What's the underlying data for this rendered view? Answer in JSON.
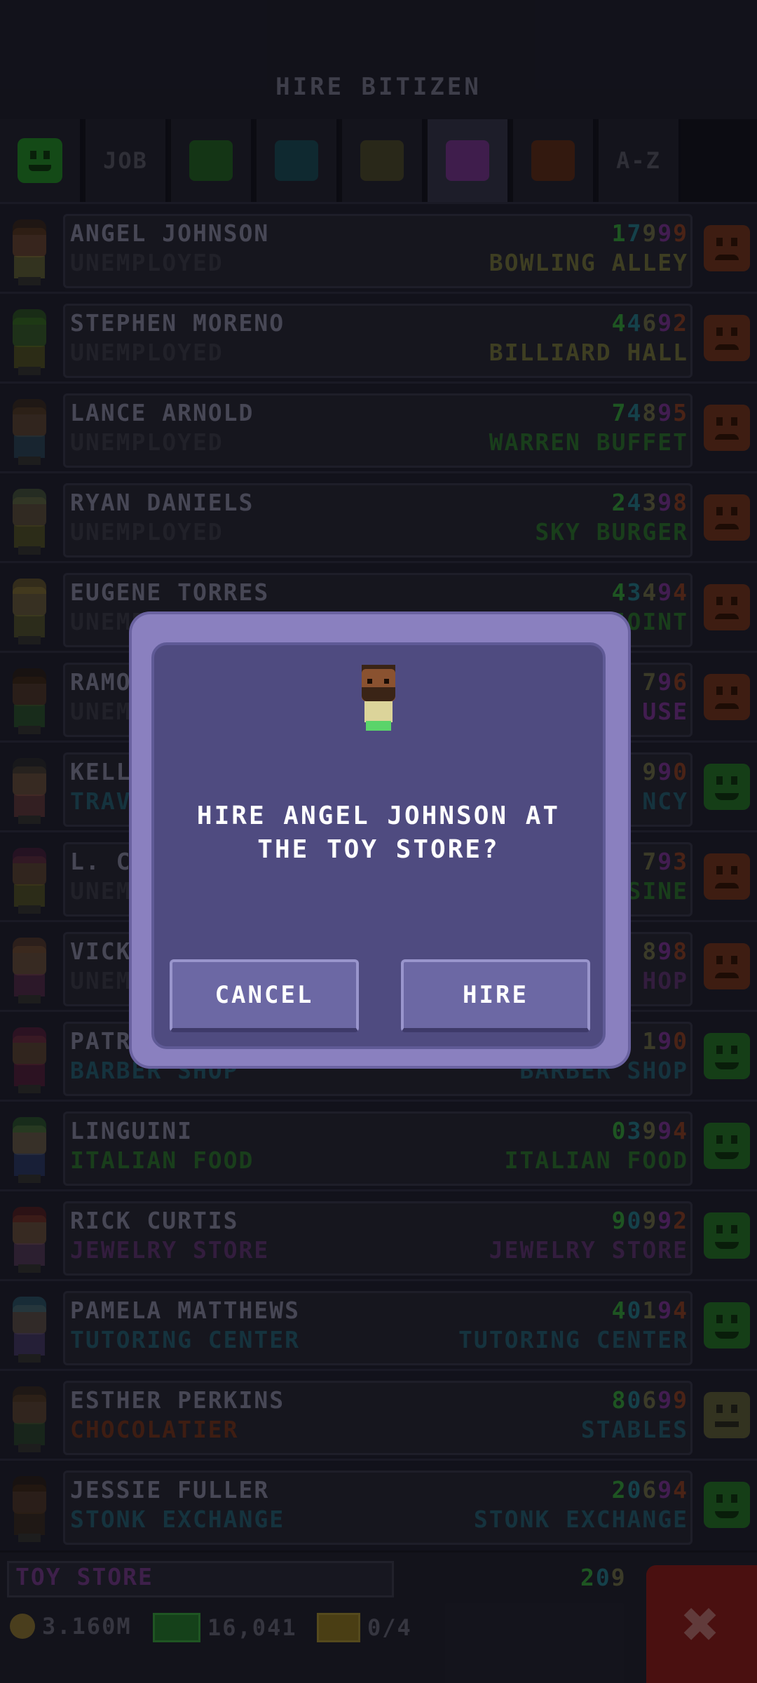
{
  "header": {
    "title": "HIRE BITIZEN"
  },
  "tabs": {
    "job_label": "JOB",
    "az_label": "A-Z",
    "colors": [
      "#1d4d1f",
      "#163c45",
      "#3c3a24",
      "#5b2a6e",
      "#4a2516"
    ]
  },
  "list": [
    {
      "name": "ANGEL JOHNSON",
      "job": "UNEMPLOYED",
      "job_color": "#30303c",
      "digits": [
        {
          "d": "1",
          "c": "#2c7a32"
        },
        {
          "d": "7",
          "c": "#1f5d6b"
        },
        {
          "d": "9",
          "c": "#55553a"
        },
        {
          "d": "9",
          "c": "#5f2a73"
        },
        {
          "d": "9",
          "c": "#6b3320"
        }
      ],
      "dream": "BOWLING ALLEY",
      "dream_color": "#5a5a32",
      "mood": "sad",
      "skin": "#7a4a2e",
      "hair": "#3a2416",
      "shirt": "#6b6b32"
    },
    {
      "name": "STEPHEN MORENO",
      "job": "UNEMPLOYED",
      "job_color": "#30303c",
      "digits": [
        {
          "d": "4",
          "c": "#2c7a32"
        },
        {
          "d": "4",
          "c": "#1f5d6b"
        },
        {
          "d": "6",
          "c": "#55553a"
        },
        {
          "d": "9",
          "c": "#5f2a73"
        },
        {
          "d": "2",
          "c": "#6b3320"
        }
      ],
      "dream": "BILLIARD HALL",
      "dream_color": "#5a5a32",
      "mood": "sad",
      "skin": "#3a6b22",
      "hair": "#2c5a1c",
      "shirt": "#5a5a1d"
    },
    {
      "name": "LANCE ARNOLD",
      "job": "UNEMPLOYED",
      "job_color": "#30303c",
      "digits": [
        {
          "d": "7",
          "c": "#2c7a32"
        },
        {
          "d": "4",
          "c": "#1f5d6b"
        },
        {
          "d": "8",
          "c": "#55553a"
        },
        {
          "d": "9",
          "c": "#5f2a73"
        },
        {
          "d": "5",
          "c": "#6b3320"
        }
      ],
      "dream": "WARREN BUFFET",
      "dream_color": "#245a27",
      "mood": "sad",
      "skin": "#6b4a30",
      "hair": "#3a2a1a",
      "shirt": "#2a4a5a"
    },
    {
      "name": "RYAN DANIELS",
      "job": "UNEMPLOYED",
      "job_color": "#30303c",
      "digits": [
        {
          "d": "2",
          "c": "#2c7a32"
        },
        {
          "d": "4",
          "c": "#1f5d6b"
        },
        {
          "d": "3",
          "c": "#55553a"
        },
        {
          "d": "9",
          "c": "#5f2a73"
        },
        {
          "d": "8",
          "c": "#6b3320"
        }
      ],
      "dream": "SKY BURGER",
      "dream_color": "#245a27",
      "mood": "sad",
      "skin": "#6b5a3a",
      "hair": "#4a5a3a",
      "shirt": "#5a5a22"
    },
    {
      "name": "EUGENE TORRES",
      "job": "UNEMPLOYED",
      "job_color": "#30303c",
      "digits": [
        {
          "d": "4",
          "c": "#2c7a32"
        },
        {
          "d": "3",
          "c": "#1f5d6b"
        },
        {
          "d": "4",
          "c": "#55553a"
        },
        {
          "d": "9",
          "c": "#5f2a73"
        },
        {
          "d": "4",
          "c": "#6b3320"
        }
      ],
      "dream": "HOT DOG JOINT",
      "dream_color": "#245a27",
      "mood": "sad",
      "skin": "#7a6a3a",
      "hair": "#6b5a2a",
      "shirt": "#5a5a2a"
    },
    {
      "name": "RAMON",
      "job": "UNEMPLOYED",
      "job_color": "#30303c",
      "digits": [
        {
          "d": "7",
          "c": "#55553a"
        },
        {
          "d": "9",
          "c": "#5f2a73"
        },
        {
          "d": "6",
          "c": "#6b3320"
        }
      ],
      "dream": "USE",
      "dream_color": "#5f2a73",
      "mood": "sad",
      "skin": "#5a3a22",
      "hair": "#2a1a10",
      "shirt": "#2a5a2a"
    },
    {
      "name": "KELLY",
      "job": "TRAVEL",
      "job_color": "#1f4a5a",
      "digits": [
        {
          "d": "9",
          "c": "#55553a"
        },
        {
          "d": "9",
          "c": "#5f2a73"
        },
        {
          "d": "0",
          "c": "#6b3320"
        }
      ],
      "dream": "NCY",
      "dream_color": "#1f4a5a",
      "mood": "happy",
      "skin": "#7a5a3a",
      "hair": "#2a2a2a",
      "shirt": "#6b3a3a"
    },
    {
      "name": "L. CARSON",
      "job": "UNEMPLOYED",
      "job_color": "#30303c",
      "digits": [
        {
          "d": "7",
          "c": "#55553a"
        },
        {
          "d": "9",
          "c": "#5f2a73"
        },
        {
          "d": "3",
          "c": "#6b3320"
        }
      ],
      "dream": "SINE",
      "dream_color": "#245a27",
      "mood": "sad",
      "skin": "#6b4a30",
      "hair": "#4a1a3a",
      "shirt": "#5a5a22"
    },
    {
      "name": "VICKY",
      "job": "UNEMPLOYED",
      "job_color": "#30303c",
      "digits": [
        {
          "d": "8",
          "c": "#55553a"
        },
        {
          "d": "9",
          "c": "#5f2a73"
        },
        {
          "d": "8",
          "c": "#6b3320"
        }
      ],
      "dream": "HOP",
      "dream_color": "#4a2a5a",
      "mood": "sad",
      "skin": "#7a5a3a",
      "hair": "#5a3a2a",
      "shirt": "#5a2a4a"
    },
    {
      "name": "PATRICIA",
      "job": "BARBER SHOP",
      "job_color": "#1f4a5a",
      "digits": [
        {
          "d": "1",
          "c": "#55553a"
        },
        {
          "d": "9",
          "c": "#5f2a73"
        },
        {
          "d": "0",
          "c": "#6b3320"
        }
      ],
      "dream": "BARBER SHOP",
      "dream_color": "#1f4a5a",
      "mood": "happy",
      "skin": "#6b4a30",
      "hair": "#5a1a3a",
      "shirt": "#5a1a3a"
    },
    {
      "name": "LINGUINI",
      "job": "ITALIAN FOOD",
      "job_color": "#245a27",
      "digits": [
        {
          "d": "0",
          "c": "#2c7a32"
        },
        {
          "d": "3",
          "c": "#1f5d6b"
        },
        {
          "d": "9",
          "c": "#55553a"
        },
        {
          "d": "9",
          "c": "#5f2a73"
        },
        {
          "d": "4",
          "c": "#6b3320"
        }
      ],
      "dream": "ITALIAN FOOD",
      "dream_color": "#245a27",
      "mood": "happy",
      "skin": "#7a6a4a",
      "hair": "#2a5a2a",
      "shirt": "#2a3a6b"
    },
    {
      "name": "RICK CURTIS",
      "job": "JEWELRY STORE",
      "job_color": "#4a2a5a",
      "digits": [
        {
          "d": "9",
          "c": "#2c7a32"
        },
        {
          "d": "0",
          "c": "#1f5d6b"
        },
        {
          "d": "9",
          "c": "#55553a"
        },
        {
          "d": "9",
          "c": "#5f2a73"
        },
        {
          "d": "2",
          "c": "#6b3320"
        }
      ],
      "dream": "JEWELRY STORE",
      "dream_color": "#4a2a5a",
      "mood": "happy",
      "skin": "#7a5a3a",
      "hair": "#5a1a1a",
      "shirt": "#5a3a5a"
    },
    {
      "name": "PAMELA MATTHEWS",
      "job": "TUTORING CENTER",
      "job_color": "#1f4a5a",
      "digits": [
        {
          "d": "4",
          "c": "#2c7a32"
        },
        {
          "d": "0",
          "c": "#1f5d6b"
        },
        {
          "d": "1",
          "c": "#55553a"
        },
        {
          "d": "9",
          "c": "#5f2a73"
        },
        {
          "d": "4",
          "c": "#6b3320"
        }
      ],
      "dream": "TUTORING CENTER",
      "dream_color": "#1f4a5a",
      "mood": "happy",
      "skin": "#6b5a4a",
      "hair": "#2a5a6b",
      "shirt": "#4a3a6b"
    },
    {
      "name": "ESTHER PERKINS",
      "job": "CHOCOLATIER",
      "job_color": "#5a2a1a",
      "digits": [
        {
          "d": "8",
          "c": "#2c7a32"
        },
        {
          "d": "0",
          "c": "#1f5d6b"
        },
        {
          "d": "6",
          "c": "#55553a"
        },
        {
          "d": "9",
          "c": "#5f2a73"
        },
        {
          "d": "9",
          "c": "#6b3320"
        }
      ],
      "dream": "STABLES",
      "dream_color": "#1f4a5a",
      "mood": "neutral",
      "skin": "#6b4a30",
      "hair": "#3a2a1a",
      "shirt": "#2a4a2a"
    },
    {
      "name": "JESSIE FULLER",
      "job": "STONK EXCHANGE",
      "job_color": "#1f4a5a",
      "digits": [
        {
          "d": "2",
          "c": "#2c7a32"
        },
        {
          "d": "0",
          "c": "#1f5d6b"
        },
        {
          "d": "6",
          "c": "#55553a"
        },
        {
          "d": "9",
          "c": "#5f2a73"
        },
        {
          "d": "4",
          "c": "#6b3320"
        }
      ],
      "dream": "STONK EXCHANGE",
      "dream_color": "#1f4a5a",
      "mood": "happy",
      "skin": "#5a3a22",
      "hair": "#2a1a10",
      "shirt": "#3a2a1a"
    }
  ],
  "footer": {
    "floor_name": "TOY STORE",
    "floor_digits": [
      {
        "d": "2",
        "c": "#2c7a32"
      },
      {
        "d": "0",
        "c": "#1f5d6b"
      },
      {
        "d": "9",
        "c": "#55553a"
      }
    ],
    "coins": "3.160M",
    "bux": "16,041",
    "tickets": "0/4",
    "close_icon": "✖"
  },
  "dialog": {
    "message_line1": "HIRE ANGEL JOHNSON AT",
    "message_line2": "THE TOY STORE?",
    "cancel_label": "CANCEL",
    "hire_label": "HIRE"
  },
  "mood_colors": {
    "sad": {
      "bg": "#5a2a1a",
      "fg": "#2a1208"
    },
    "happy": {
      "bg": "#1f5a22",
      "fg": "#0d2a0f"
    },
    "neutral": {
      "bg": "#4a4a2e",
      "fg": "#22221a"
    }
  }
}
